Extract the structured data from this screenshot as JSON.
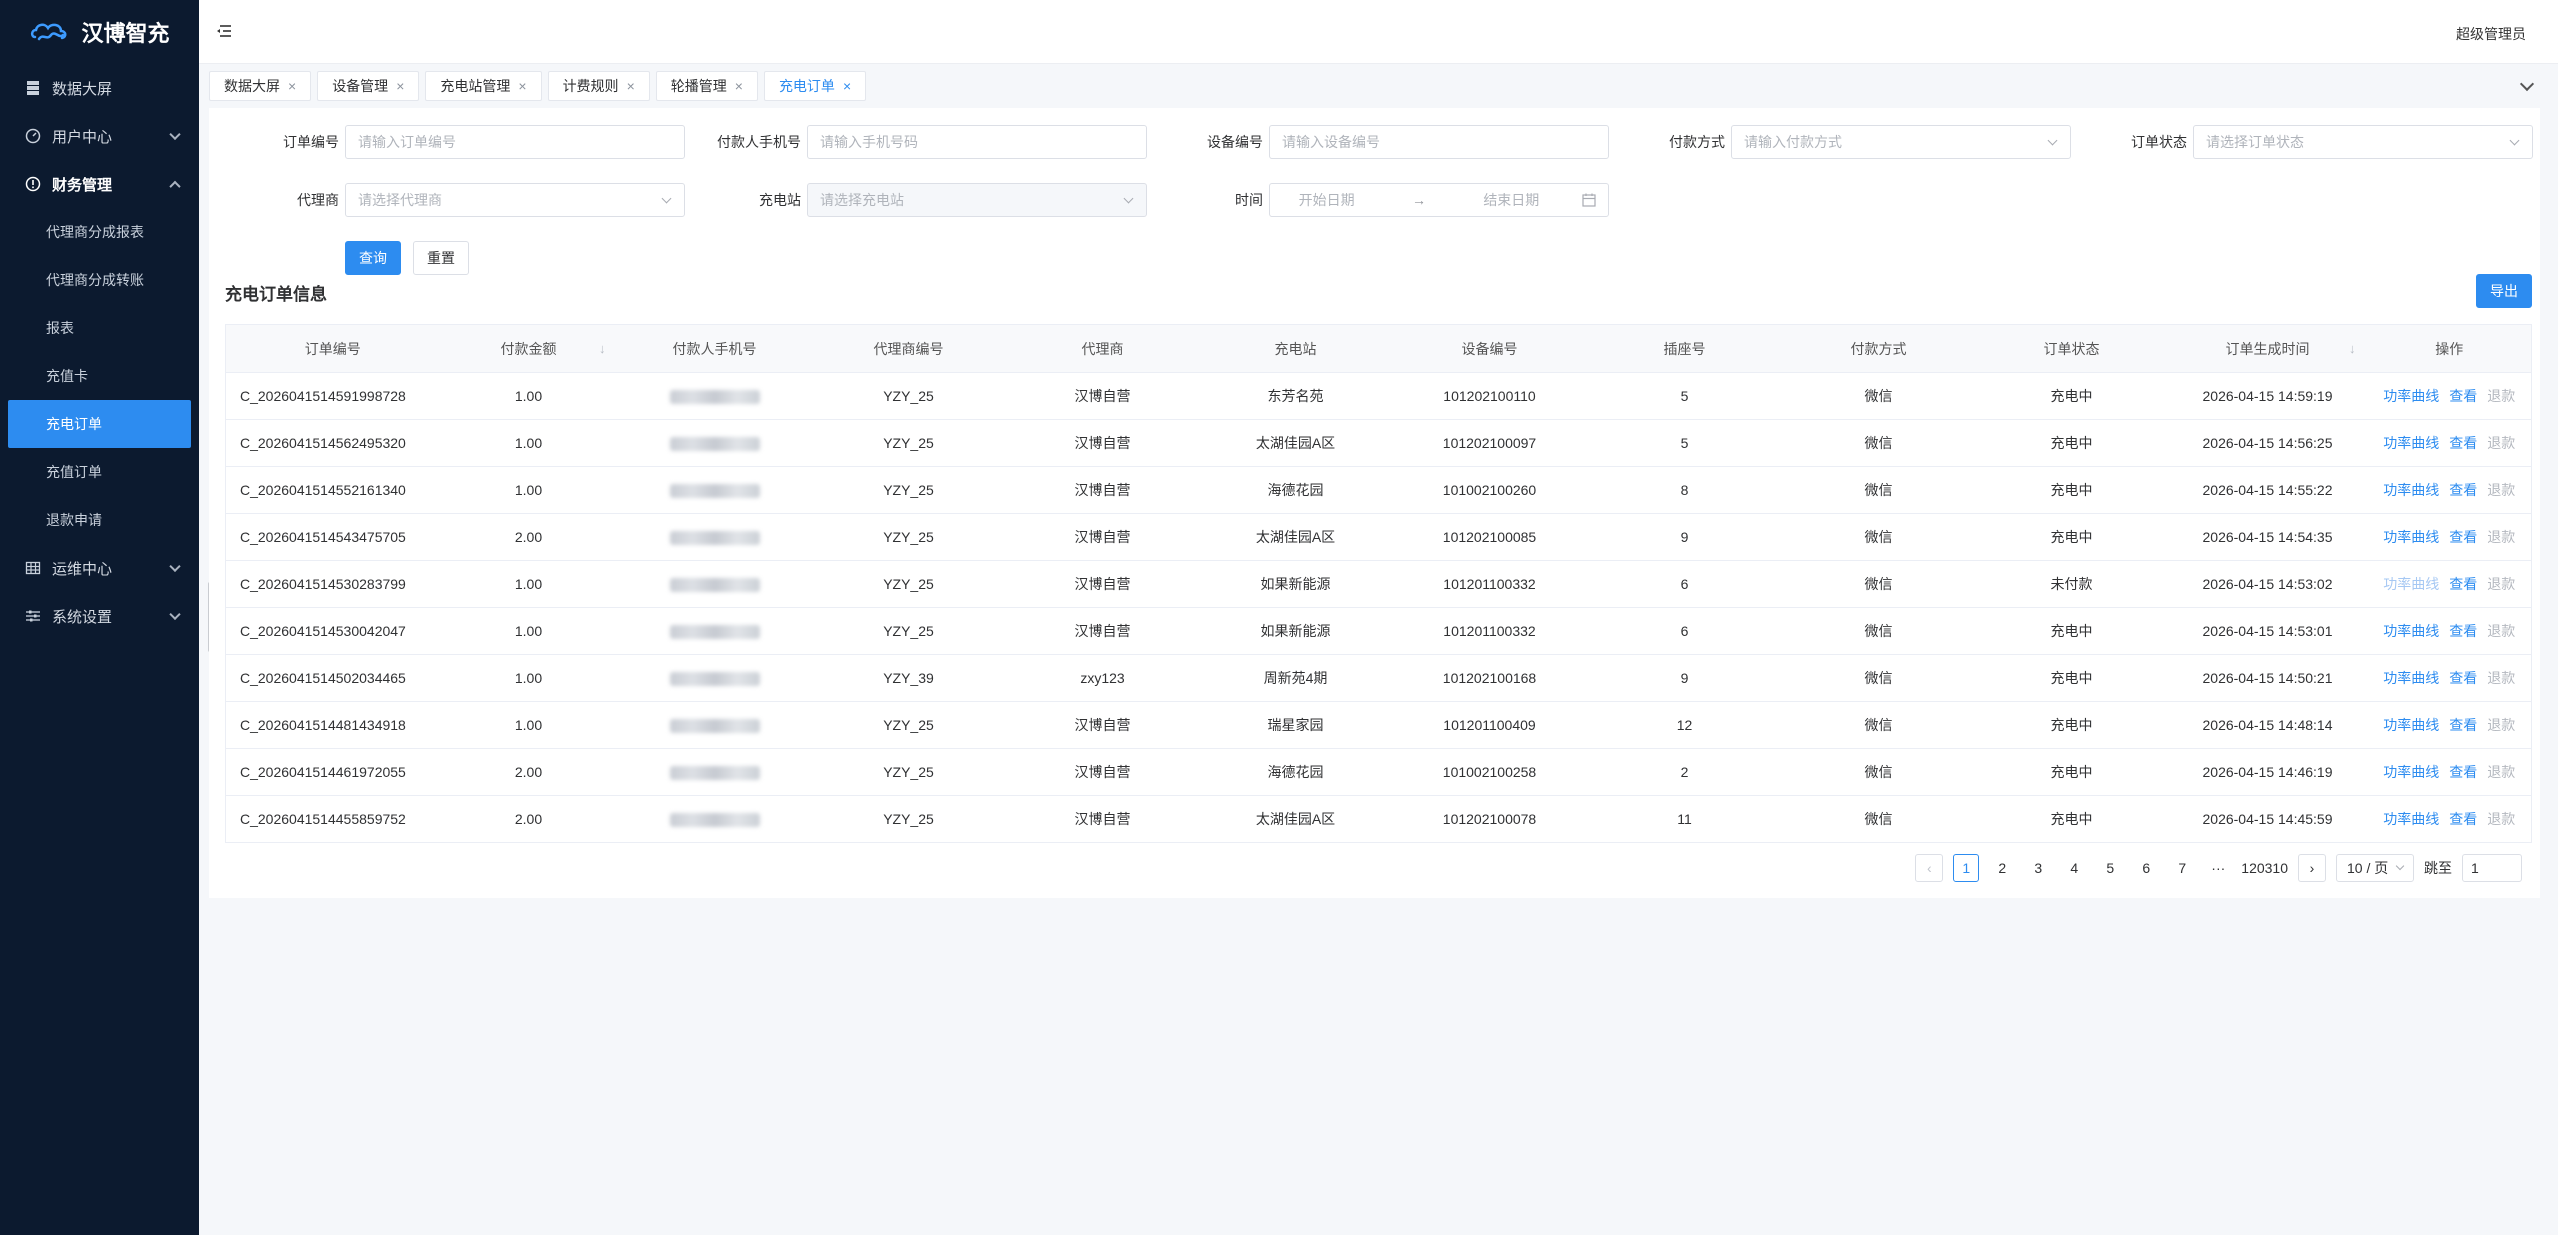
{
  "app": {
    "title": "汉博智充"
  },
  "header": {
    "user": "超级管理员"
  },
  "sidebar": {
    "items": [
      {
        "label": "数据大屏",
        "icon": "database-icon"
      },
      {
        "label": "用户中心",
        "icon": "dashboard-icon"
      },
      {
        "label": "财务管理",
        "icon": "alert-circle-icon",
        "children": [
          "代理商分成报表",
          "代理商分成转账",
          "报表",
          "充值卡",
          "充电订单",
          "充值订单",
          "退款申请"
        ]
      },
      {
        "label": "运维中心",
        "icon": "grid-icon"
      },
      {
        "label": "系统设置",
        "icon": "sliders-icon"
      }
    ],
    "active_child": "充电订单"
  },
  "tabs": [
    "数据大屏",
    "设备管理",
    "充电站管理",
    "计费规则",
    "轮播管理",
    "充电订单"
  ],
  "active_tab": "充电订单",
  "filters": {
    "order_no": {
      "label": "订单编号",
      "placeholder": "请输入订单编号"
    },
    "payer_phone": {
      "label": "付款人手机号",
      "placeholder": "请输入手机号码"
    },
    "device_no": {
      "label": "设备编号",
      "placeholder": "请输入设备编号"
    },
    "pay_method": {
      "label": "付款方式",
      "placeholder": "请输入付款方式"
    },
    "order_status": {
      "label": "订单状态",
      "placeholder": "请选择订单状态"
    },
    "agent": {
      "label": "代理商",
      "placeholder": "请选择代理商"
    },
    "station": {
      "label": "充电站",
      "placeholder": "请选择充电站"
    },
    "time": {
      "label": "时间",
      "start": "开始日期",
      "end": "结束日期",
      "sep": "→"
    }
  },
  "buttons": {
    "query": "查询",
    "reset": "重置",
    "export": "导出"
  },
  "section_title": "充电订单信息",
  "table": {
    "columns": [
      "订单编号",
      "付款金额",
      "付款人手机号",
      "代理商编号",
      "代理商",
      "充电站",
      "设备编号",
      "插座号",
      "付款方式",
      "订单状态",
      "订单生成时间",
      "操作"
    ],
    "rows": [
      [
        "C_2026041514591998728",
        "1.00",
        "",
        "YZY_25",
        "汉博自营",
        "东芳名苑",
        "101202100110",
        "5",
        "微信",
        "充电中",
        "2026-04-15 14:59:19"
      ],
      [
        "C_2026041514562495320",
        "1.00",
        "",
        "YZY_25",
        "汉博自营",
        "太湖佳园A区",
        "101202100097",
        "5",
        "微信",
        "充电中",
        "2026-04-15 14:56:25"
      ],
      [
        "C_2026041514552161340",
        "1.00",
        "",
        "YZY_25",
        "汉博自营",
        "海德花园",
        "101002100260",
        "8",
        "微信",
        "充电中",
        "2026-04-15 14:55:22"
      ],
      [
        "C_2026041514543475705",
        "2.00",
        "",
        "YZY_25",
        "汉博自营",
        "太湖佳园A区",
        "101202100085",
        "9",
        "微信",
        "充电中",
        "2026-04-15 14:54:35"
      ],
      [
        "C_2026041514530283799",
        "1.00",
        "",
        "YZY_25",
        "汉博自营",
        "如果新能源",
        "101201100332",
        "6",
        "微信",
        "未付款",
        "2026-04-15 14:53:02"
      ],
      [
        "C_2026041514530042047",
        "1.00",
        "",
        "YZY_25",
        "汉博自营",
        "如果新能源",
        "101201100332",
        "6",
        "微信",
        "充电中",
        "2026-04-15 14:53:01"
      ],
      [
        "C_2026041514502034465",
        "1.00",
        "",
        "YZY_39",
        "zxy123",
        "周新苑4期",
        "101202100168",
        "9",
        "微信",
        "充电中",
        "2026-04-15 14:50:21"
      ],
      [
        "C_2026041514481434918",
        "1.00",
        "",
        "YZY_25",
        "汉博自营",
        "瑞星家园",
        "101201100409",
        "12",
        "微信",
        "充电中",
        "2026-04-15 14:48:14"
      ],
      [
        "C_2026041514461972055",
        "2.00",
        "",
        "YZY_25",
        "汉博自营",
        "海德花园",
        "101002100258",
        "2",
        "微信",
        "充电中",
        "2026-04-15 14:46:19"
      ],
      [
        "C_2026041514455859752",
        "2.00",
        "",
        "YZY_25",
        "汉博自营",
        "太湖佳园A区",
        "101202100078",
        "11",
        "微信",
        "充电中",
        "2026-04-15 14:45:59"
      ]
    ],
    "actions": {
      "curve": "功率曲线",
      "view": "查看",
      "refund": "退款"
    }
  },
  "pagination": {
    "pages": [
      "1",
      "2",
      "3",
      "4",
      "5",
      "6",
      "7"
    ],
    "ellipsis": "···",
    "last": "120310",
    "current": "1",
    "page_size": "10 / 页",
    "jump_label": "跳至",
    "jump_value": "1"
  },
  "colors": {
    "primary": "#2d8cf0",
    "sidebar": "#0c1a2f"
  }
}
